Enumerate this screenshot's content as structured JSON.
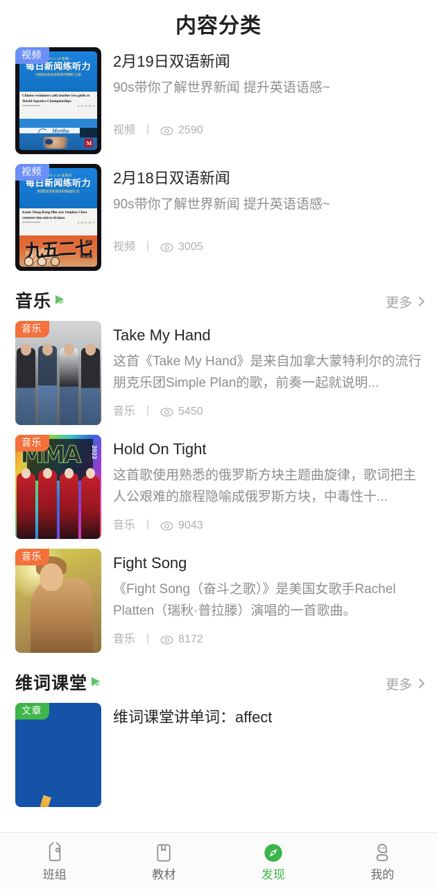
{
  "header": {
    "title": "内容分类"
  },
  "sections": [
    {
      "id": "video",
      "has_header": false,
      "items": [
        {
          "badge": "视频",
          "badge_type": "video",
          "title": "2月19日双语新闻",
          "desc": "90s带你了解世界新闻 提升英语语感~",
          "meta_type": "视频",
          "meta_sep": "丨",
          "views": "2590",
          "thumb_kind": "news-pool",
          "thumb_overlay_date": "2024.2.19 星期一",
          "thumb_overlay_title": "每日新闻练听力",
          "thumb_overlay_sub": "中国游泳队再添两金世锦赛行之旅",
          "thumb_overlay_en": "Chinese swimmers add another two golds at World Aquatics Championships"
        },
        {
          "badge": "视频",
          "badge_type": "video",
          "title": "2月18日双语新闻",
          "desc": "90s带你了解世界新闻 提升英语语感~",
          "meta_type": "视频",
          "meta_sep": "丨",
          "views": "3005",
          "thumb_kind": "news-poster",
          "thumb_overlay_date": "2024.2.18 星期日",
          "thumb_overlay_title": "每日新闻练听力",
          "thumb_overlay_sub": "香港影星周星驰进军微短剧行业",
          "thumb_overlay_en": "Iconic Hong Kong film star Stephen Chow ventures into micro-dramas",
          "thumb_poster_text": "九五二七",
          "thumb_poster_tag": "剧场",
          "thumb_poster_credit": "周星驰"
        }
      ]
    },
    {
      "id": "music",
      "has_header": true,
      "header_title": "音乐",
      "more_label": "更多",
      "items": [
        {
          "badge": "音乐",
          "badge_type": "music",
          "title": "Take My Hand",
          "desc": "这首《Take My Hand》是来自加拿大蒙特利尔的流行朋克乐团Simple Plan的歌，前奏一起就说明...",
          "meta_type": "音乐",
          "meta_sep": "丨",
          "views": "5450",
          "thumb_kind": "band"
        },
        {
          "badge": "音乐",
          "badge_type": "music",
          "title": "Hold On Tight",
          "desc": "这首歌使用熟悉的俄罗斯方块主题曲旋律，歌词把主人公艰难的旅程隐喻成俄罗斯方块，中毒性十...",
          "meta_type": "音乐",
          "meta_sep": "丨",
          "views": "9043",
          "thumb_kind": "mma",
          "thumb_overlay_title": "MMA",
          "thumb_overlay_year": "2023"
        },
        {
          "badge": "音乐",
          "badge_type": "music",
          "title": "Fight Song",
          "desc": "《Fight Song（奋斗之歌）》是美国女歌手Rachel Platten（瑞秋·普拉滕）演唱的一首歌曲。",
          "meta_type": "音乐",
          "meta_sep": "丨",
          "views": "8172",
          "thumb_kind": "fight"
        }
      ]
    },
    {
      "id": "weici",
      "has_header": true,
      "header_title": "维词课堂",
      "more_label": "更多",
      "items": [
        {
          "badge": "文章",
          "badge_type": "article",
          "title": "维词课堂讲单词：affect",
          "thumb_kind": "article"
        }
      ]
    }
  ],
  "bottom_nav": {
    "active_index": 2,
    "items": [
      {
        "label": "班组",
        "icon": "tag-icon"
      },
      {
        "label": "教材",
        "icon": "book-icon"
      },
      {
        "label": "发现",
        "icon": "compass-icon"
      },
      {
        "label": "我的",
        "icon": "person-icon"
      }
    ]
  },
  "colors": {
    "accent_green": "#3cb44a",
    "badge_video": "#6b8ff5",
    "badge_music": "#f4713c",
    "badge_article": "#3fb54a",
    "title_text": "#262626",
    "muted_text": "#8e8e93",
    "meta_text": "#aeaeb2"
  }
}
